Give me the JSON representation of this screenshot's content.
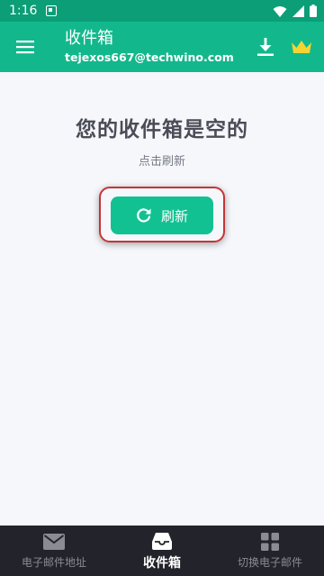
{
  "status_bar": {
    "time": "1:16",
    "app_icon": "a-square-icon",
    "wifi_icon": "wifi-icon",
    "signal_icon": "signal-icon",
    "battery_icon": "battery-icon"
  },
  "app_bar": {
    "title": "收件箱",
    "email": "tejexos667@techwino.com",
    "menu_icon": "menu-icon",
    "download_icon": "download-icon",
    "premium_icon": "crown-icon",
    "crown_color": "#f2d533"
  },
  "empty_state": {
    "title": "您的收件箱是空的",
    "hint": "点击刷新",
    "refresh_label": "刷新",
    "refresh_icon": "refresh-icon"
  },
  "bottom_nav": {
    "items": [
      {
        "label": "电子邮件地址",
        "icon": "mail-icon",
        "active": false
      },
      {
        "label": "收件箱",
        "icon": "inbox-icon",
        "active": true
      },
      {
        "label": "切换电子邮件",
        "icon": "grid-icon",
        "active": false
      }
    ]
  },
  "colors": {
    "status_bar": "#0b9e77",
    "app_bar": "#12b88c",
    "button": "#12c192",
    "highlight": "#c53535",
    "nav_background": "#23232b"
  }
}
